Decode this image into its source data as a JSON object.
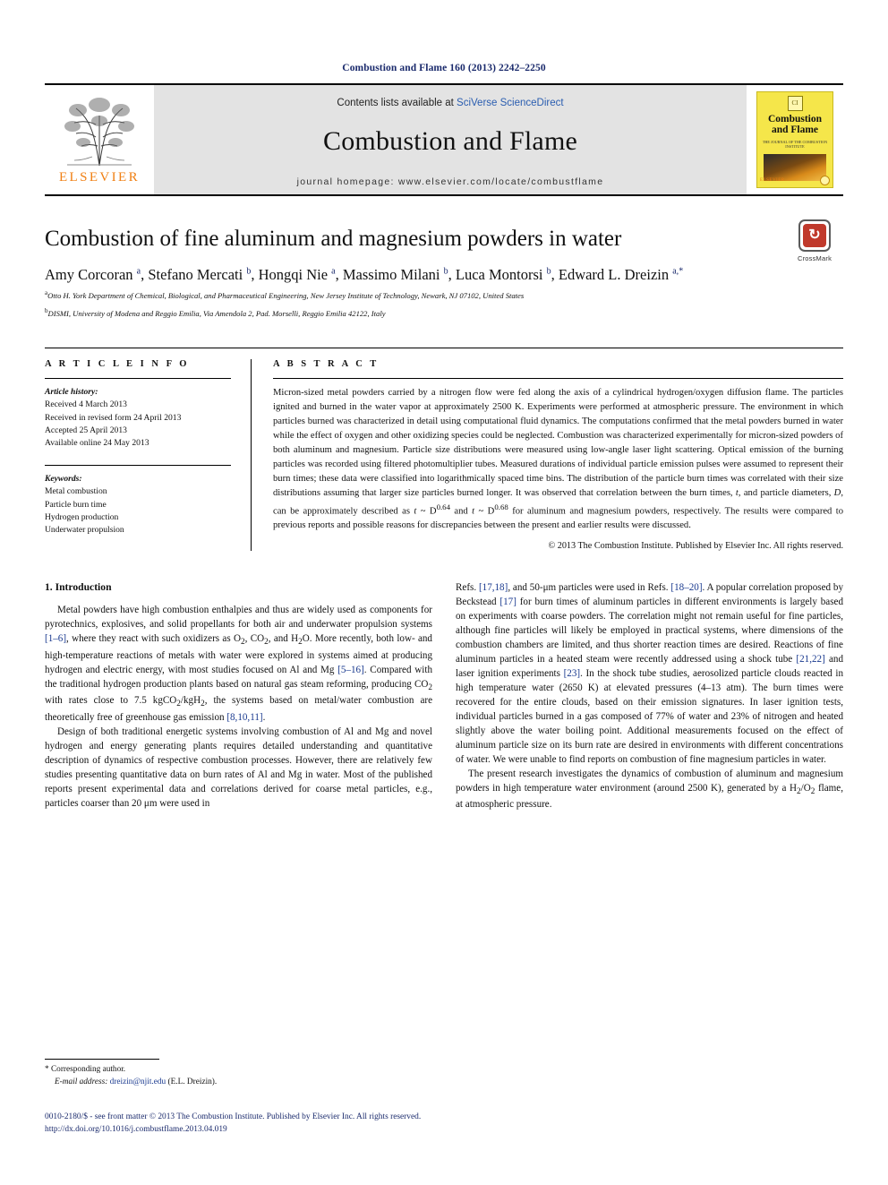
{
  "running_head": "Combustion and Flame 160 (2013) 2242–2250",
  "masthead": {
    "publisher_logo_name": "elsevier-tree-logo",
    "publisher_wordmark": "ELSEVIER",
    "contents_prefix": "Contents lists available at ",
    "contents_link": "SciVerse ScienceDirect",
    "journal_name": "Combustion and Flame",
    "homepage_line": "journal homepage: www.elsevier.com/locate/combustflame",
    "cover": {
      "title_line1": "Combustion",
      "title_line2": "and Flame",
      "subtitle": "THE JOURNAL OF THE COMBUSTION INSTITUTE",
      "corner_mark": "CI",
      "publisher": "ELSEVIER"
    }
  },
  "article": {
    "title": "Combustion of fine aluminum and magnesium powders in water",
    "crossmark": {
      "glyph": "↻",
      "label": "CrossMark"
    },
    "authors_html": "Amy Corcoran <sup>a</sup>, Stefano Mercati <sup>b</sup>, Hongqi Nie <sup>a</sup>, Massimo Milani <sup>b</sup>, Luca Montorsi <sup>b</sup>, Edward L. Dreizin <sup>a,</sup><sup>*</sup>",
    "affiliations": [
      "Otto H. York Department of Chemical, Biological, and Pharmaceutical Engineering, New Jersey Institute of Technology, Newark, NJ 07102, United States",
      "DISMI, University of Modena and Reggio Emilia, Via Amendola 2, Pad. Morselli, Reggio Emilia 42122, Italy"
    ],
    "affiliation_marks": [
      "a",
      "b"
    ]
  },
  "article_info": {
    "heading": "A R T I C L E   I N F O",
    "history_title": "Article history:",
    "history": [
      "Received 4 March 2013",
      "Received in revised form 24 April 2013",
      "Accepted 25 April 2013",
      "Available online 24 May 2013"
    ],
    "keywords_title": "Keywords:",
    "keywords": [
      "Metal combustion",
      "Particle burn time",
      "Hydrogen production",
      "Underwater propulsion"
    ]
  },
  "abstract": {
    "heading": "A B S T R A C T",
    "text": "Micron-sized metal powders carried by a nitrogen flow were fed along the axis of a cylindrical hydrogen/oxygen diffusion flame. The particles ignited and burned in the water vapor at approximately 2500 K. Experiments were performed at atmospheric pressure. The environment in which particles burned was characterized in detail using computational fluid dynamics. The computations confirmed that the metal powders burned in water while the effect of oxygen and other oxidizing species could be neglected. Combustion was characterized experimentally for micron-sized powders of both aluminum and magnesium. Particle size distributions were measured using low-angle laser light scattering. Optical emission of the burning particles was recorded using filtered photomultiplier tubes. Measured durations of individual particle emission pulses were assumed to represent their burn times; these data were classified into logarithmically spaced time bins. The distribution of the particle burn times was correlated with their size distributions assuming that larger size particles burned longer. It was observed that correlation between the burn times, t, and particle diameters, D, can be approximately described as t ~ D0.64 and t ~ D0.68 for aluminum and magnesium powders, respectively. The results were compared to previous reports and possible reasons for discrepancies between the present and earlier results were discussed.",
    "copyright": "© 2013 The Combustion Institute. Published by Elsevier Inc. All rights reserved."
  },
  "body": {
    "section_title": "1. Introduction",
    "left_paragraphs": [
      "Metal powders have high combustion enthalpies and thus are widely used as components for pyrotechnics, explosives, and solid propellants for both air and underwater propulsion systems [1–6], where they react with such oxidizers as O2, CO2, and H2O. More recently, both low- and high-temperature reactions of metals with water were explored in systems aimed at producing hydrogen and electric energy, with most studies focused on Al and Mg [5–16]. Compared with the traditional hydrogen production plants based on natural gas steam reforming, producing CO2 with rates close to 7.5 kgCO2/kgH2, the systems based on metal/water combustion are theoretically free of greenhouse gas emission [8,10,11].",
      "Design of both traditional energetic systems involving combustion of Al and Mg and novel hydrogen and energy generating plants requires detailed understanding and quantitative description of dynamics of respective combustion processes. However, there are relatively few studies presenting quantitative data on burn rates of Al and Mg in water. Most of the published reports present experimental data and correlations derived for coarse metal particles, e.g., particles coarser than 20 μm were used in"
    ],
    "right_paragraphs": [
      "Refs. [17,18], and 50-μm particles were used in Refs. [18–20]. A popular correlation proposed by Beckstead [17] for burn times of aluminum particles in different environments is largely based on experiments with coarse powders. The correlation might not remain useful for fine particles, although fine particles will likely be employed in practical systems, where dimensions of the combustion chambers are limited, and thus shorter reaction times are desired. Reactions of fine aluminum particles in a heated steam were recently addressed using a shock tube [21,22] and laser ignition experiments [23]. In the shock tube studies, aerosolized particle clouds reacted in high temperature water (2650 K) at elevated pressures (4–13 atm). The burn times were recovered for the entire clouds, based on their emission signatures. In laser ignition tests, individual particles burned in a gas composed of 77% of water and 23% of nitrogen and heated slightly above the water boiling point. Additional measurements focused on the effect of aluminum particle size on its burn rate are desired in environments with different concentrations of water. We were unable to find reports on combustion of fine magnesium particles in water.",
      "The present research investigates the dynamics of combustion of aluminum and magnesium powders in high temperature water environment (around 2500 K), generated by a H2/O2 flame, at atmospheric pressure."
    ]
  },
  "footnote": {
    "star": "*",
    "corresponding": "Corresponding author.",
    "email_label": "E-mail address:",
    "email": "dreizin@njit.edu",
    "email_owner": "(E.L. Dreizin)."
  },
  "bottom": {
    "issn_line": "0010-2180/$ - see front matter © 2013 The Combustion Institute. Published by Elsevier Inc. All rights reserved.",
    "doi_line": "http://dx.doi.org/10.1016/j.combustflame.2013.04.019"
  },
  "colors": {
    "link_blue": "#1a3a8f",
    "elsevier_orange": "#f07f12",
    "mast_gray": "#e3e3e3",
    "cover_yellow": "#f5e64a",
    "crossmark_red": "#c0392b"
  }
}
